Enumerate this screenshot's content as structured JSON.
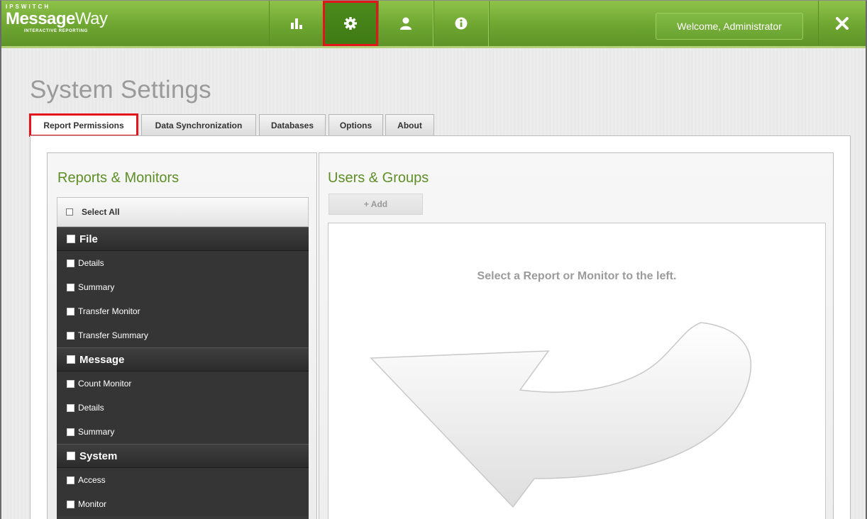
{
  "app": {
    "brand_top": "IPSWITCH",
    "brand_main_bold": "Message",
    "brand_main_thin": "Way",
    "brand_sub": "INTERACTIVE REPORTING"
  },
  "nav": {
    "items": [
      {
        "name": "reports",
        "icon": "bar-chart-icon"
      },
      {
        "name": "settings",
        "icon": "gear-icon",
        "active": true
      },
      {
        "name": "users",
        "icon": "user-icon"
      },
      {
        "name": "info",
        "icon": "info-icon"
      }
    ],
    "welcome": "Welcome, Administrator",
    "close_icon": "close-icon"
  },
  "page": {
    "title": "System Settings"
  },
  "tabs": [
    {
      "label": "Report Permissions",
      "active": true
    },
    {
      "label": "Data Synchronization"
    },
    {
      "label": "Databases"
    },
    {
      "label": "Options"
    },
    {
      "label": "About"
    }
  ],
  "left": {
    "title": "Reports & Monitors",
    "select_all": "Select All",
    "groups": [
      {
        "label": "File",
        "items": [
          "Details",
          "Summary",
          "Transfer Monitor",
          "Transfer Summary"
        ]
      },
      {
        "label": "Message",
        "items": [
          "Count Monitor",
          "Details",
          "Summary"
        ]
      },
      {
        "label": "System",
        "items": [
          "Access",
          "Monitor"
        ]
      }
    ]
  },
  "right": {
    "title": "Users & Groups",
    "add_label": "+ Add",
    "empty_message": "Select a Report or Monitor to the left."
  },
  "colors": {
    "accent_green": "#6ea631",
    "title_green": "#5e8f26",
    "highlight_red": "#e3141b"
  }
}
